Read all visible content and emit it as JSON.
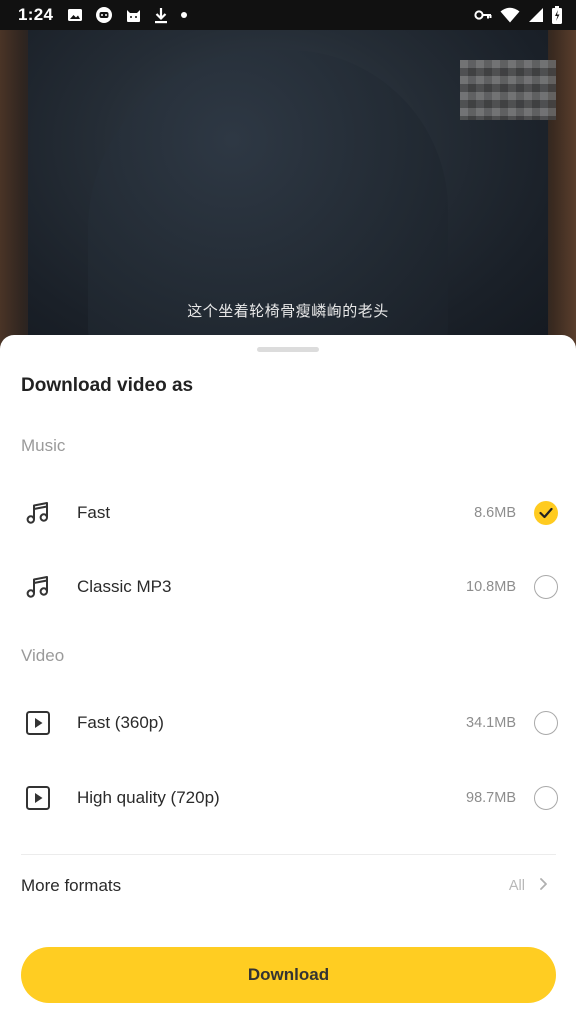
{
  "status_bar": {
    "time": "1:24",
    "left_icons": [
      "image-icon",
      "assistant-icon",
      "cat-icon",
      "download-icon",
      "dot-icon"
    ],
    "right_icons": [
      "key-icon",
      "wifi-icon",
      "signal-icon",
      "battery-icon"
    ]
  },
  "video": {
    "subtitle": "这个坐着轮椅骨瘦嶙峋的老头"
  },
  "sheet": {
    "title": "Download video as",
    "sections": [
      {
        "header": "Music",
        "options": [
          {
            "icon": "music-note-icon",
            "label": "Fast",
            "size": "8.6MB",
            "selected": true
          },
          {
            "icon": "music-note-icon",
            "label": "Classic MP3",
            "size": "10.8MB",
            "selected": false
          }
        ]
      },
      {
        "header": "Video",
        "options": [
          {
            "icon": "play-box-icon",
            "label": "Fast (360p)",
            "size": "34.1MB",
            "selected": false
          },
          {
            "icon": "play-box-icon",
            "label": "High quality (720p)",
            "size": "98.7MB",
            "selected": false
          }
        ]
      }
    ],
    "more_formats": {
      "label": "More formats",
      "value": "All"
    },
    "download_button": "Download"
  },
  "colors": {
    "accent": "#ffcd22",
    "check": "#ffcb20"
  }
}
